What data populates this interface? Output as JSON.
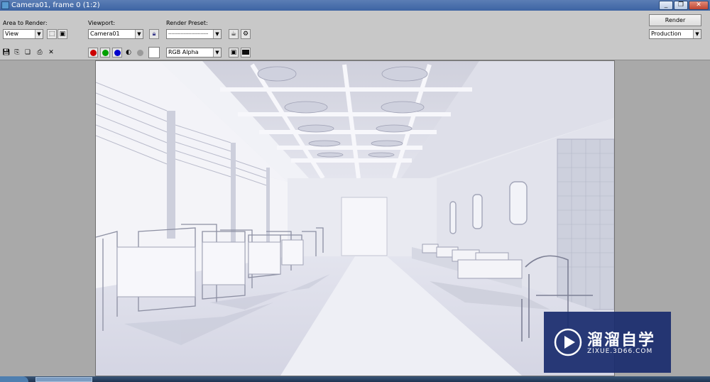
{
  "window": {
    "title": "Camera01, frame 0 (1:2)",
    "controls": {
      "minimize": "_",
      "restore": "❐",
      "close": "✕"
    }
  },
  "toolbar": {
    "area_label": "Area to Render:",
    "area_value": "View",
    "viewport_label": "Viewport:",
    "viewport_value": "Camera01",
    "preset_label": "Render Preset:",
    "preset_value": "--------------------------",
    "render_button": "Render",
    "production_value": "Production",
    "channel_value": "RGB Alpha",
    "channel_colors": {
      "red": "#cc0000",
      "green": "#00a000",
      "blue": "#0000cc"
    }
  },
  "watermark": {
    "cn_text": "溜溜自学",
    "en_text": "ZIXUE.3D66.COM"
  },
  "icons": [
    "save-icon",
    "copy-icon",
    "clone-icon",
    "print-icon",
    "clear-icon",
    "lock-icon",
    "teapot-icon",
    "settings-icon",
    "mono-icon",
    "alpha-icon"
  ]
}
